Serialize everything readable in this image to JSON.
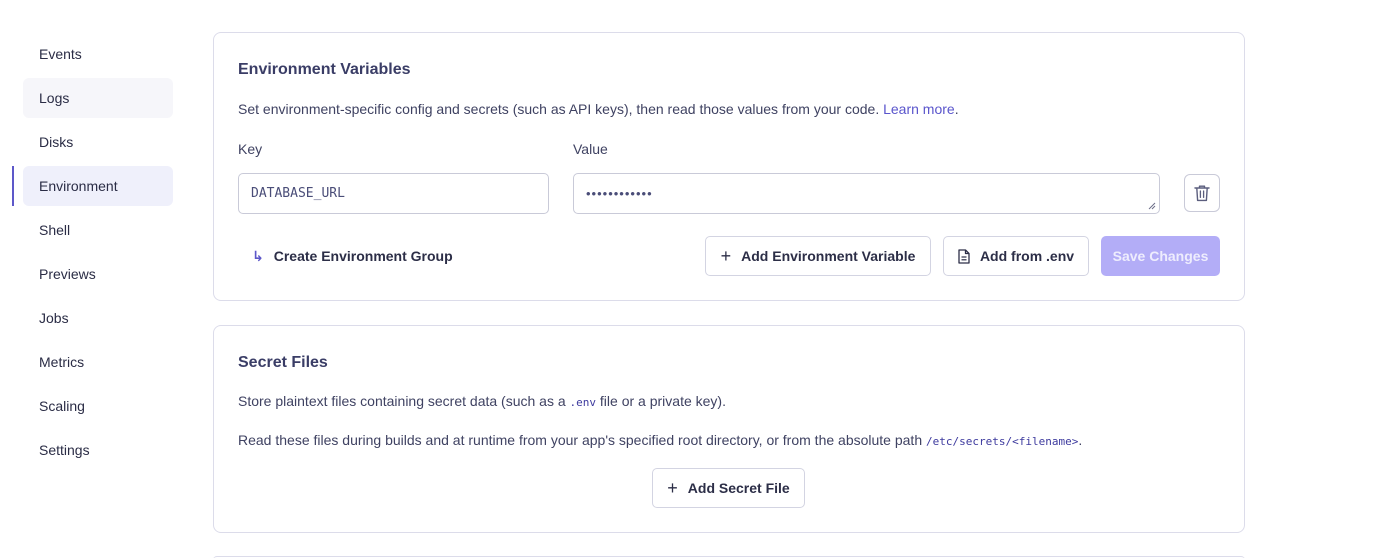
{
  "sidebar": {
    "items": [
      {
        "label": "Events"
      },
      {
        "label": "Logs"
      },
      {
        "label": "Disks"
      },
      {
        "label": "Environment"
      },
      {
        "label": "Shell"
      },
      {
        "label": "Previews"
      },
      {
        "label": "Jobs"
      },
      {
        "label": "Metrics"
      },
      {
        "label": "Scaling"
      },
      {
        "label": "Settings"
      }
    ],
    "active": "Environment",
    "hovered": "Logs"
  },
  "env_vars": {
    "title": "Environment Variables",
    "description": "Set environment-specific config and secrets (such as API keys), then read those values from your code.",
    "learn_more": "Learn more",
    "description_end": ".",
    "key_label": "Key",
    "value_label": "Value",
    "rows": [
      {
        "key": "DATABASE_URL",
        "value_masked": "••••••••••••"
      }
    ],
    "delete_icon": "trash-icon",
    "create_group_label": "Create Environment Group",
    "add_variable_label": "Add Environment Variable",
    "add_from_env_label": "Add from .env",
    "save_label": "Save Changes"
  },
  "secret_files": {
    "title": "Secret Files",
    "line1_pre": "Store plaintext files containing secret data (such as a",
    "line1_code": ".env",
    "line1_post": "file or a private key).",
    "line2_pre": "Read these files during builds and at runtime from your app's specified root directory, or from the absolute path",
    "line2_code": "/etc/secrets/<filename>",
    "line2_post": ".",
    "add_label": "Add Secret File"
  },
  "colors": {
    "accent": "#5d58c9",
    "primary_disabled": "#b3adf7",
    "border": "#dcdcea"
  }
}
